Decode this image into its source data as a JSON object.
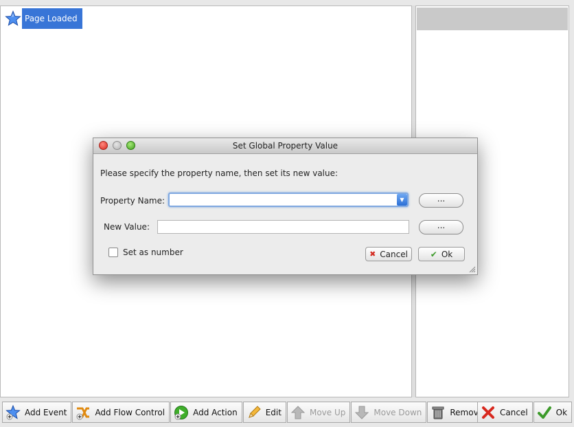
{
  "tree": {
    "root_label": "Page Loaded",
    "root_icon": "star-icon"
  },
  "dialog": {
    "title": "Set Global Property Value",
    "prompt": "Please specify the property name, then set its new value:",
    "property_name_label": "Property Name:",
    "property_name_value": "",
    "property_browse_label": "...",
    "new_value_label": "New Value:",
    "new_value_value": "",
    "value_browse_label": "...",
    "set_as_number_label": "Set as number",
    "set_as_number_checked": false,
    "cancel_label": "Cancel",
    "ok_label": "Ok"
  },
  "toolbar": {
    "add_event": "Add Event",
    "add_flow_control": "Add Flow Control",
    "add_action": "Add Action",
    "edit": "Edit",
    "move_up": "Move Up",
    "move_down": "Move Down",
    "remove": "Remove",
    "cancel": "Cancel",
    "ok": "Ok"
  },
  "colors": {
    "selection": "#3875d7",
    "focus_ring": "#7fa8e0"
  }
}
